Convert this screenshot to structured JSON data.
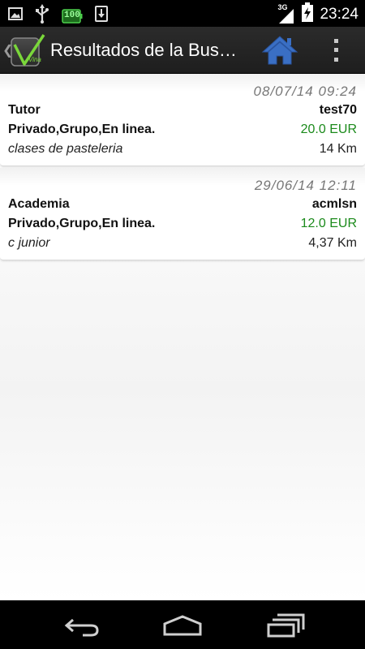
{
  "status_bar": {
    "time": "23:24",
    "network": "3G",
    "battery_label": "100",
    "icons": [
      "image-icon",
      "usb-icon",
      "battery-100-icon",
      "download-icon",
      "signal-icon",
      "battery-charging-icon"
    ]
  },
  "action_bar": {
    "title": "Resultados de la Bus…",
    "logo_text": "Vina",
    "icons": [
      "app-logo-icon",
      "home-icon",
      "overflow-menu-icon"
    ],
    "colors": {
      "background": "#222222",
      "home": "#3a6fc4",
      "logo_green": "#7ad73a"
    }
  },
  "results": [
    {
      "date": "08/07/14  09:24",
      "type": "Tutor",
      "user": "test70",
      "modalities": "Privado,Grupo,En linea.",
      "price": "20.0 EUR",
      "subject": "clases de pasteleria",
      "distance": "14 Km"
    },
    {
      "date": "29/06/14  12:11",
      "type": "Academia",
      "user": "acmlsn",
      "modalities": "Privado,Grupo,En linea.",
      "price": "12.0 EUR",
      "subject": "c junior",
      "distance": "4,37 Km"
    }
  ],
  "nav_bar": {
    "icons": [
      "back-icon",
      "home-nav-icon",
      "recent-apps-icon"
    ]
  },
  "colors": {
    "price": "#1b8a1b",
    "date": "#777777"
  }
}
